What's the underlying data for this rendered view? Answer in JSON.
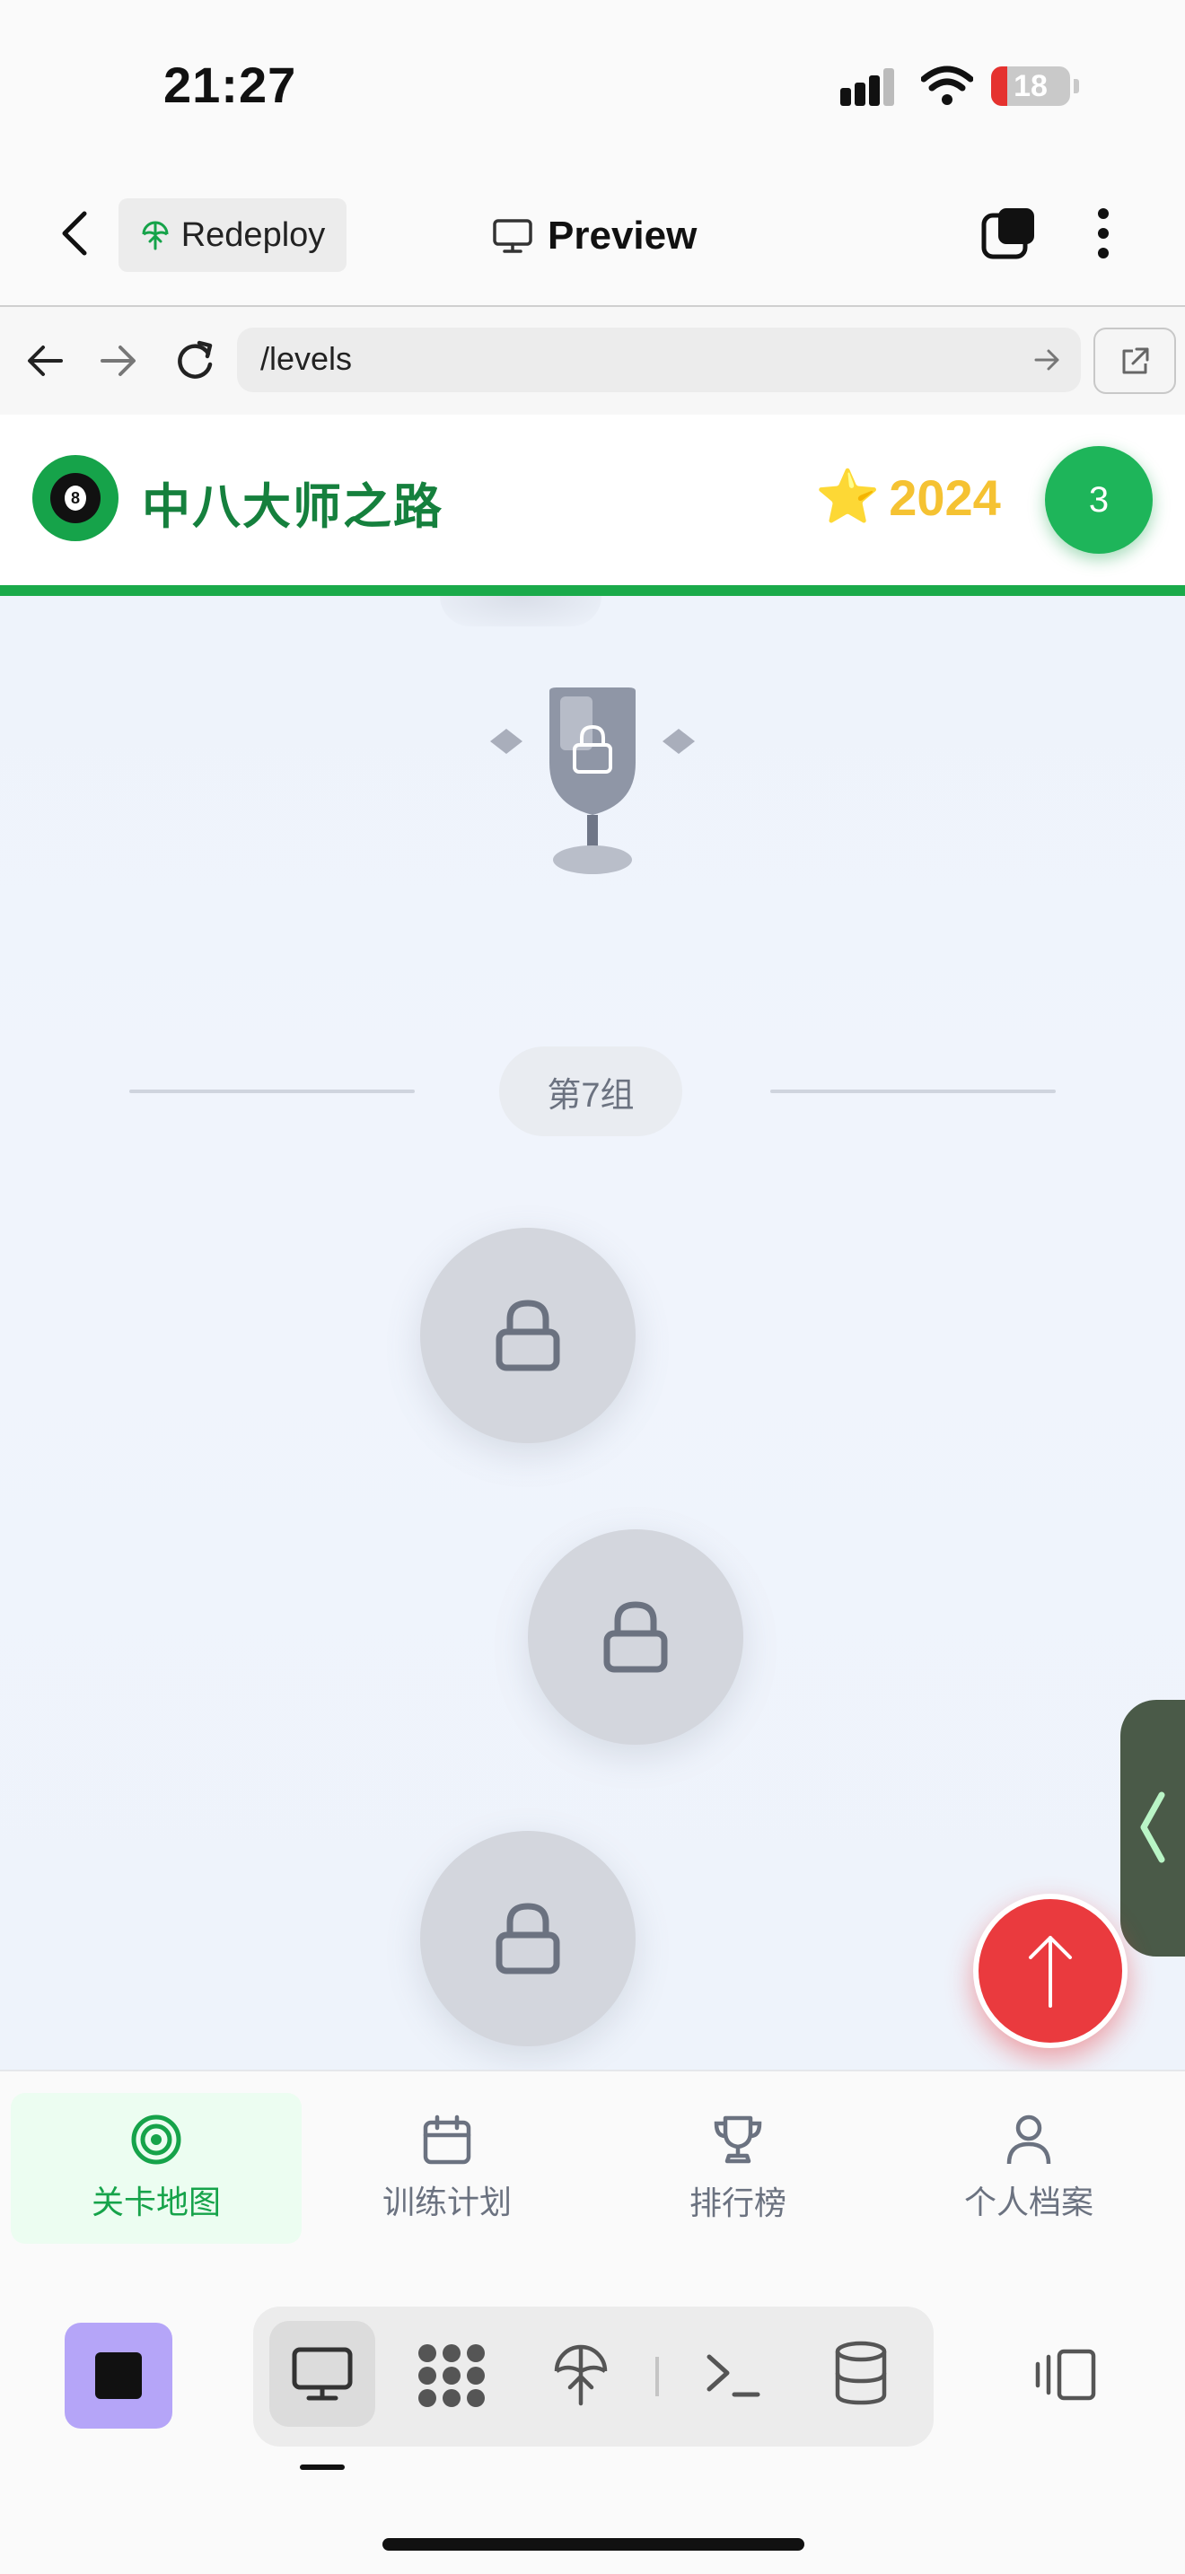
{
  "status_bar": {
    "time": "21:27",
    "battery": "18"
  },
  "app_bar": {
    "redeploy_label": "Redeploy",
    "preview_label": "Preview"
  },
  "browser": {
    "url": "/levels"
  },
  "site": {
    "title": "中八大师之路",
    "score_icon": "⭐",
    "score": "2024",
    "level": "3"
  },
  "map": {
    "group_label": "第7组"
  },
  "tabs": [
    {
      "label": "关卡地图",
      "icon": "target-icon",
      "active": true
    },
    {
      "label": "训练计划",
      "icon": "calendar-icon"
    },
    {
      "label": "排行榜",
      "icon": "trophy-icon"
    },
    {
      "label": "个人档案",
      "icon": "user-icon"
    }
  ],
  "colors": {
    "brand_green": "#16a34a",
    "score_gold": "#f5c232",
    "fab_red": "#ea3a3e",
    "stop_purple": "#b5a5f8"
  }
}
